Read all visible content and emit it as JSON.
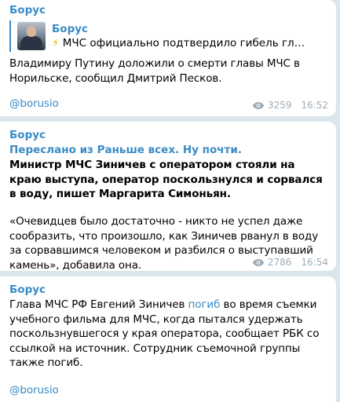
{
  "messages": [
    {
      "sender": "Борус",
      "reply": {
        "name": "Борус",
        "snippet_icon": "⚡",
        "snippet": " МЧС официально подтвердило гибель главы ведо..."
      },
      "text": "Владимиру Путину доложили о смерти главы МЧС в Норильске, сообщил Дмитрий Песков.",
      "signature": "@borusio",
      "views": "3259",
      "time": "16:52"
    },
    {
      "sender": "Борус",
      "forwarded": "Переслано из Раньше всех. Ну почти.",
      "bold_text": "Министр МЧС Зиничев с оператором стояли на краю выступа, оператор поскользнулся и сорвался в воду, пишет Маргарита Симоньян.",
      "text": "«Очевидцев было достаточно - никто не успел даже сообразить, что произошло, как Зиничев рванул в воду за сорвавшимся человеком и разбился о выступавший камень», добавила она.",
      "views": "2786",
      "time": "16:54"
    },
    {
      "sender": "Борус",
      "text_before": "Глава МЧС РФ Евгений Зиничев ",
      "link": "погиб",
      "text_after": " во время съемки учебного фильма для МЧС, когда пытался удержать поскользнувшегося у края оператора, сообщает РБК со ссылкой на источник. Сотрудник съемочной группы также погиб.",
      "signature": "@borusio"
    }
  ],
  "colors": {
    "background": "#dbe6ec",
    "accent": "#3a8bc5",
    "meta": "#a0acb6"
  },
  "icons": [
    "eye-icon",
    "lightning-icon",
    "avatar"
  ]
}
